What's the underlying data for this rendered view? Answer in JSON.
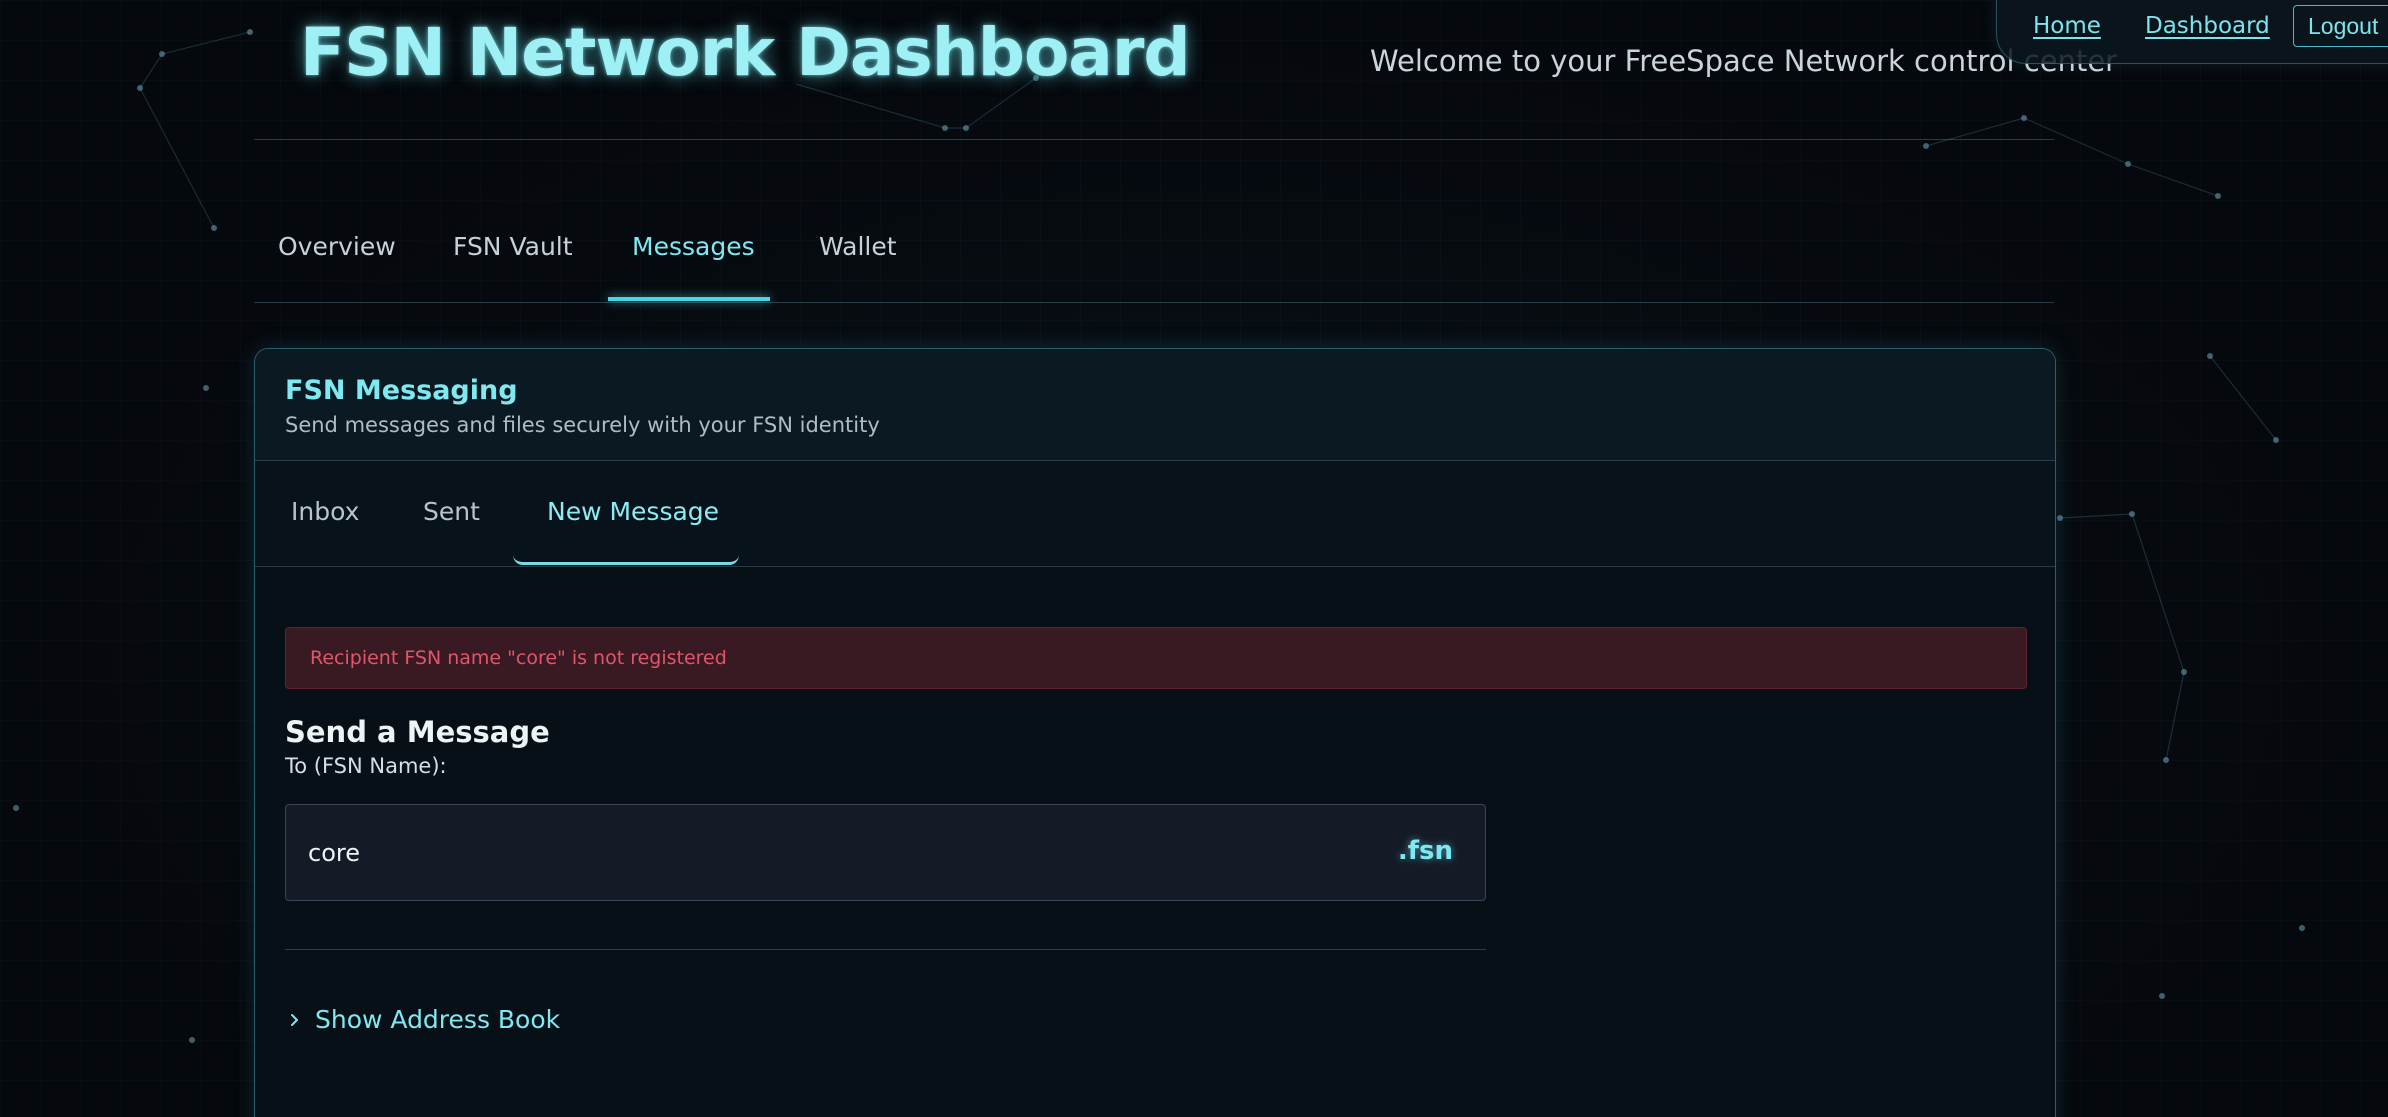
{
  "header": {
    "title": "FSN Network Dashboard",
    "welcome": "Welcome to your FreeSpace Network control center"
  },
  "top_nav": {
    "home": "Home",
    "dashboard": "Dashboard",
    "logout": "Logout"
  },
  "main_tabs": [
    {
      "label": "Overview",
      "active": false
    },
    {
      "label": "FSN Vault",
      "active": false
    },
    {
      "label": "Messages",
      "active": true
    },
    {
      "label": "Wallet",
      "active": false
    }
  ],
  "messaging": {
    "title": "FSN Messaging",
    "subtitle": "Send messages and files securely with your FSN identity",
    "tabs": [
      {
        "label": "Inbox",
        "active": false
      },
      {
        "label": "Sent",
        "active": false
      },
      {
        "label": "New Message",
        "active": true
      }
    ],
    "error": "Recipient FSN name \"core\" is not registered",
    "form": {
      "section_title": "Send a Message",
      "to_label": "To (FSN Name):",
      "to_value": "core",
      "suffix": ".fsn"
    },
    "address_book_toggle": "Show Address Book"
  },
  "colors": {
    "accent": "#7fe9f2",
    "background": "#05080c",
    "error_bg": "#3a1a22",
    "error_text": "#e0566a"
  },
  "icons": {
    "address_book_toggle": "chevron-right-icon"
  }
}
